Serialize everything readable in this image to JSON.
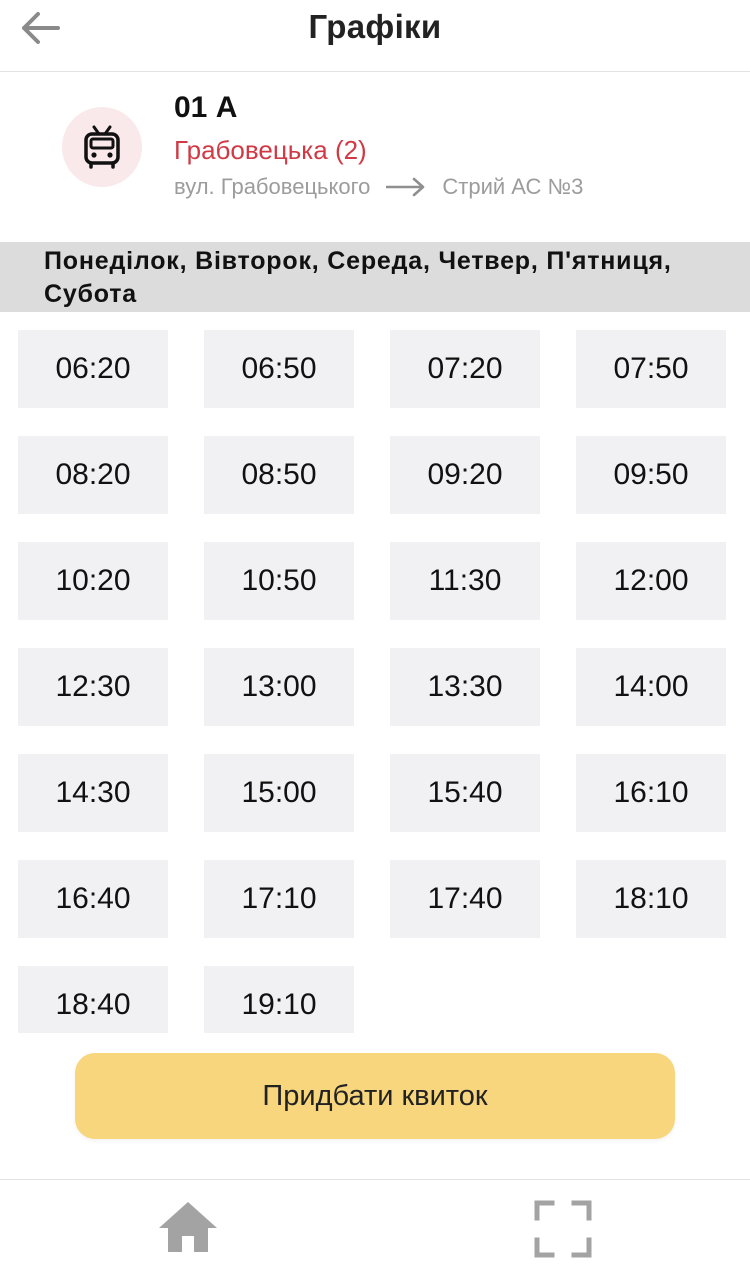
{
  "header": {
    "title": "Графіки",
    "back_icon": "arrow-left-icon"
  },
  "route": {
    "icon": "trolleybus-icon",
    "number": "01 А",
    "name": "Грабовецька (2)",
    "from": "вул. Грабовецького",
    "to": "Стрий АС №3",
    "name_color": "#d13a45"
  },
  "schedule": {
    "days": "Понеділок, Вівторок, Середа, Четвер, П'ятниця, Субота",
    "times": [
      "06:20",
      "06:50",
      "07:20",
      "07:50",
      "08:20",
      "08:50",
      "09:20",
      "09:50",
      "10:20",
      "10:50",
      "11:30",
      "12:00",
      "12:30",
      "13:00",
      "13:30",
      "14:00",
      "14:30",
      "15:00",
      "15:40",
      "16:10",
      "16:40",
      "17:10",
      "17:40",
      "18:10",
      "18:40",
      "19:10"
    ]
  },
  "buy_button": {
    "label": "Придбати квиток",
    "color": "#f7d67e"
  },
  "bottom_nav": {
    "items": [
      {
        "icon": "home-icon"
      },
      {
        "icon": "scan-icon"
      }
    ]
  }
}
